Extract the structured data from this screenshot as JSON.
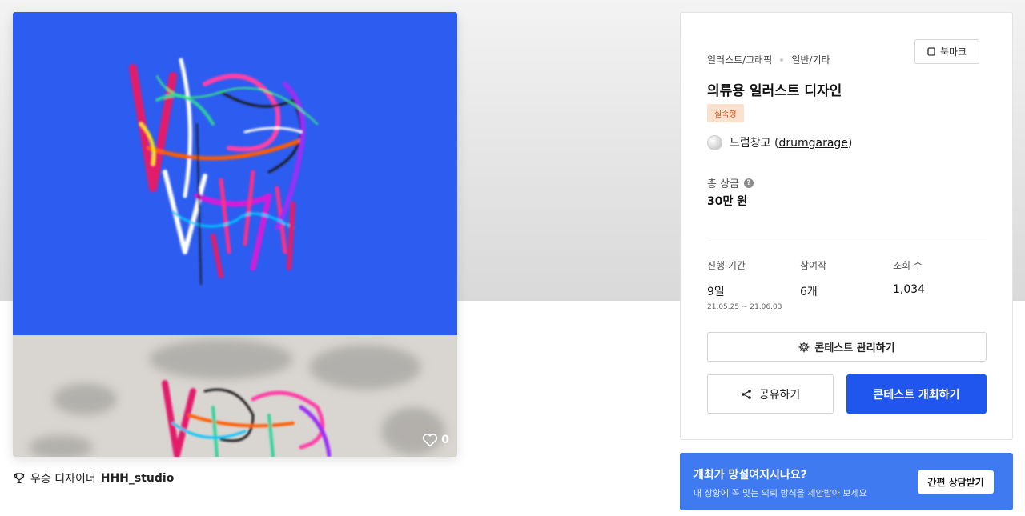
{
  "artwork": {
    "likes": "0",
    "winner_prefix": "우승 디자이너",
    "winner_name": "HHH_studio",
    "top_color": "#2d5cf0",
    "bottom_color": "#d9d6d1"
  },
  "contest": {
    "category_main": "일러스트/그래픽",
    "category_sub": "일반/기타",
    "bookmark_label": "북마크",
    "title": "의류용 일러스트 디자인",
    "badge": "실속형",
    "host_name": "드럼창고",
    "host_id": "drumgarage",
    "prize_label": "총 상금",
    "prize_help": "?",
    "prize_value": "30만 원",
    "stats": [
      {
        "label": "진행 기간",
        "value": "9일",
        "sub": "21.05.25  ~  21.06.03"
      },
      {
        "label": "참여작",
        "value": "6개",
        "sub": ""
      },
      {
        "label": "조회 수",
        "value": "1,034",
        "sub": ""
      }
    ],
    "manage_label": "콘테스트 관리하기",
    "share_label": "공유하기",
    "host_contest_label": "콘테스트 개최하기",
    "accent": "#2156ee"
  },
  "promo": {
    "title": "개최가 망설여지시나요?",
    "subtitle": "내 상황에 꼭 맞는 의뢰 방식을 제안받아 보세요",
    "button": "간편 상담받기",
    "color": "#3f7af0"
  }
}
